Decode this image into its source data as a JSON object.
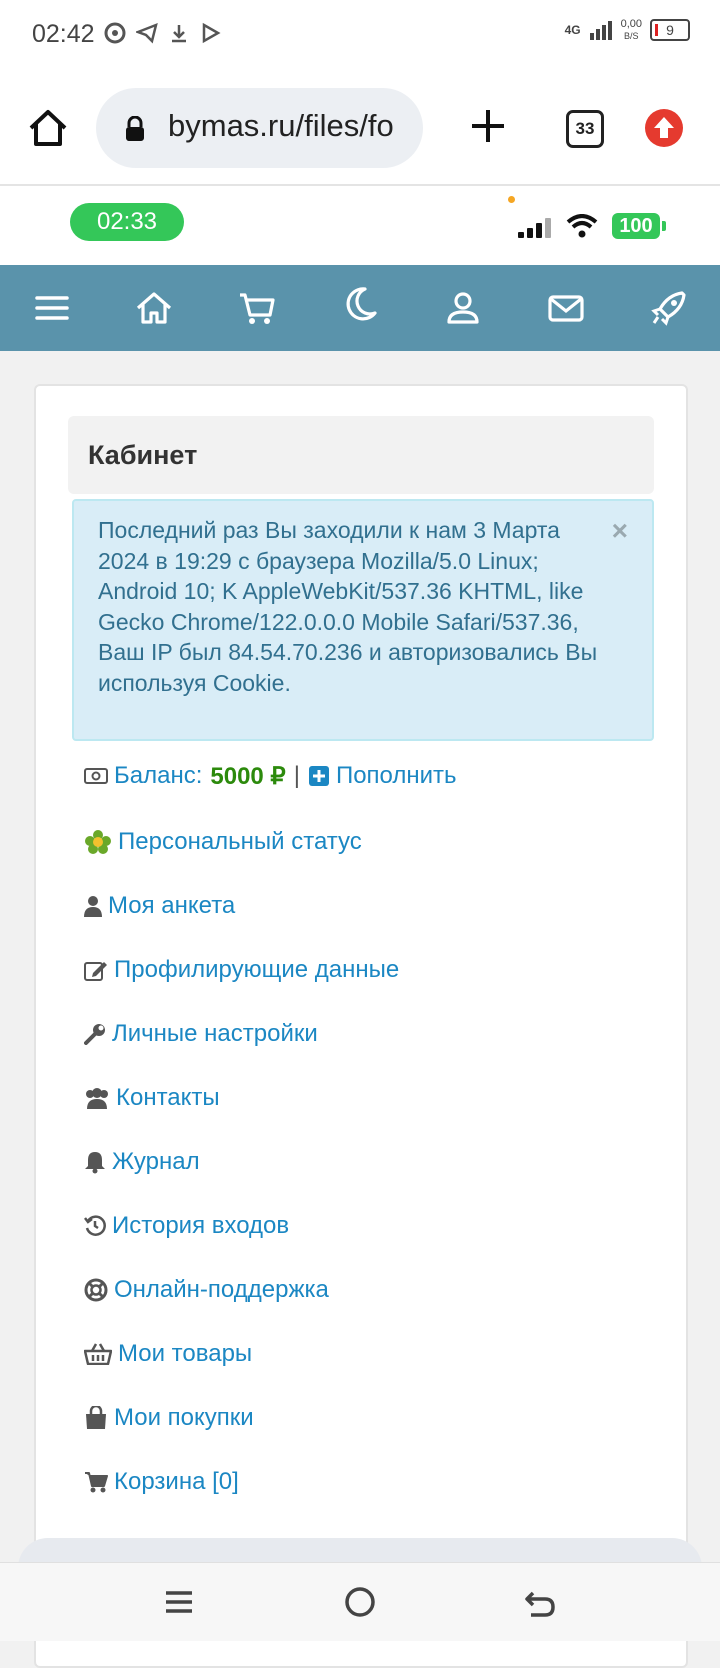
{
  "status_bar": {
    "time": "02:42",
    "network": "4G",
    "speed_value": "0,00",
    "speed_unit": "B/S",
    "battery": "9"
  },
  "browser": {
    "url": "bymas.ru/files/fo",
    "tab_count": "33"
  },
  "page_status": {
    "clock": "02:33",
    "battery": "100"
  },
  "navbar": {
    "icons": [
      "menu-icon",
      "home-icon",
      "cart-icon",
      "moon-icon",
      "user-icon",
      "mail-icon",
      "rocket-icon"
    ]
  },
  "card": {
    "title": "Кабинет",
    "alert": {
      "message": "Последний раз Вы заходили к нам 3 Марта 2024 в 19:29 с браузера Mozilla/5.0 Linux; Android 10; K AppleWebKit/537.36 KHTML, like Gecko Chrome/122.0.0.0 Mobile Safari/537.36, Ваш IP был 84.54.70.236 и авторизовались Вы используя Cookie.",
      "close": "×"
    },
    "balance": {
      "label": "Баланс:",
      "value": "5000 ₽",
      "separator": "|",
      "topup": "Пополнить"
    },
    "menu": [
      {
        "label": "Персональный статус",
        "icon": "flower-icon"
      },
      {
        "label": "Моя анкета",
        "icon": "user-icon"
      },
      {
        "label": "Профилирующие данные",
        "icon": "edit-icon"
      },
      {
        "label": "Личные настройки",
        "icon": "wrench-icon"
      },
      {
        "label": "Контакты",
        "icon": "users-icon"
      },
      {
        "label": "Журнал",
        "icon": "bell-icon"
      },
      {
        "label": "История входов",
        "icon": "history-icon"
      },
      {
        "label": "Онлайн-поддержка",
        "icon": "lifebuoy-icon"
      },
      {
        "label": "Мои товары",
        "icon": "basket-icon"
      },
      {
        "label": "Мои покупки",
        "icon": "shopping-bag-icon"
      },
      {
        "label": "Корзина [0]",
        "icon": "cart-icon"
      }
    ]
  },
  "colors": {
    "navbar": "#5a93ab",
    "link": "#1b87c3",
    "balance": "#2c8a0c",
    "alert_bg": "#d9edf7",
    "alert_text": "#31708f"
  }
}
